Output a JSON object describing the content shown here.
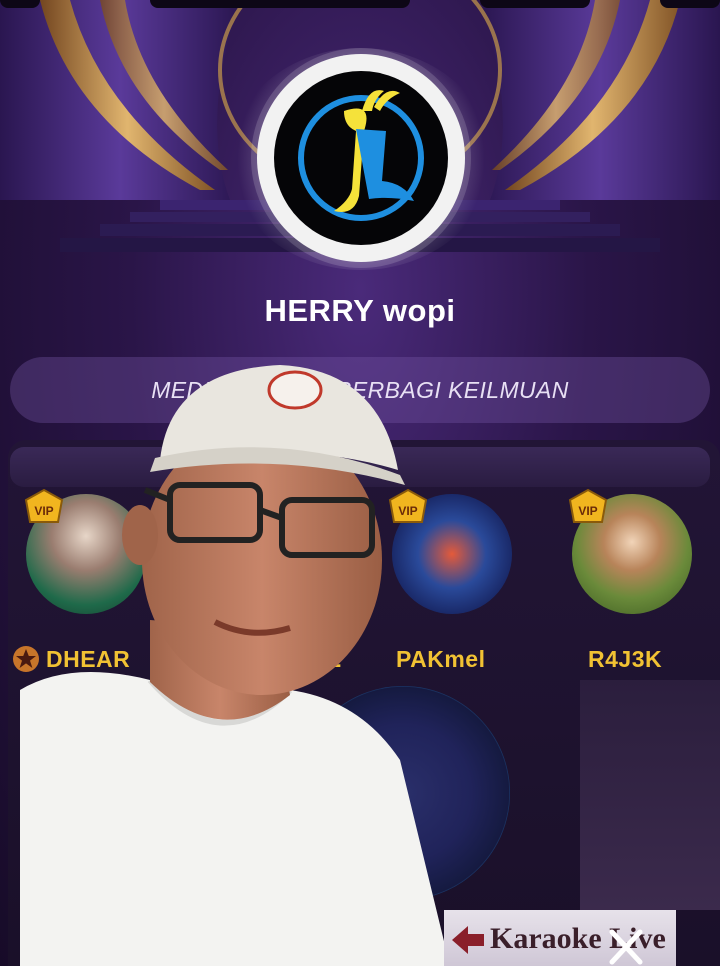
{
  "room": {
    "title": "HERRY wopi",
    "description": "MEDIA HIBUR      N BERBAGI KEILMUAN"
  },
  "seats": [
    {
      "name": "DHEAR",
      "vip": true,
      "star_badge": true
    },
    {
      "name": "L",
      "vip": false
    },
    {
      "name": "PAKmel",
      "vip": true
    },
    {
      "name": "R4J3K",
      "vip": true
    }
  ],
  "vip_label": "VIP",
  "banner": {
    "label": "Karaoke Live"
  },
  "icons": {
    "close": "close-icon",
    "vip": "vip-crown-icon",
    "star": "star-badge-icon"
  },
  "colors": {
    "accent_gold": "#f1c233",
    "background": "#1c1030",
    "text_light": "#ffffff"
  }
}
